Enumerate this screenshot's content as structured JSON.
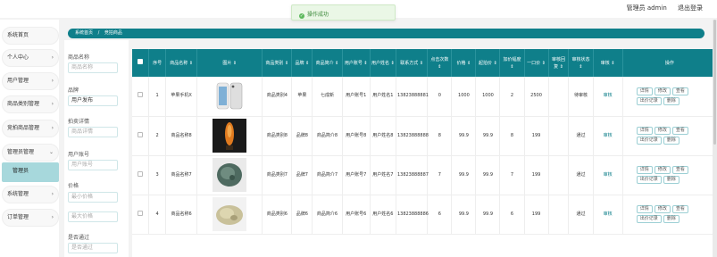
{
  "header": {
    "user_label": "管理员 admin",
    "logout": "退出登录"
  },
  "toast": {
    "message": "操作成功"
  },
  "sidebar": {
    "items": [
      {
        "label": "系统首页"
      },
      {
        "label": "个人中心"
      },
      {
        "label": "用户管理"
      },
      {
        "label": "商品类别管理"
      },
      {
        "label": "竞拍商品管理"
      },
      {
        "label": "管理员管理"
      },
      {
        "label": "系统管理"
      },
      {
        "label": "订单管理"
      }
    ],
    "active_sub": "管理员"
  },
  "breadcrumb": {
    "home": "系统首页",
    "sep": "/",
    "current": "竞拍商品"
  },
  "filters": [
    {
      "label": "商品名称",
      "placeholder": "商品名称",
      "value": ""
    },
    {
      "label": "品牌",
      "placeholder": "",
      "value": "用户发布"
    },
    {
      "label": "拍卖详情",
      "placeholder": "商品详情",
      "value": ""
    },
    {
      "label": "用户账号",
      "placeholder": "用户账号",
      "value": ""
    },
    {
      "label": "价格",
      "placeholder": "最小价格",
      "value": ""
    },
    {
      "label": "",
      "placeholder": "最大价格",
      "value": ""
    },
    {
      "label": "是否通过",
      "placeholder": "是否通过",
      "value": ""
    }
  ],
  "table": {
    "columns": [
      "",
      "序号",
      "商品名称 ⇕",
      "图片 ⇕",
      "商品类别 ⇕",
      "品牌 ⇕",
      "商品简介 ⇕",
      "用户账号 ⇕",
      "用户姓名 ⇕",
      "联系方式 ⇕",
      "点击次数 ⇕",
      "价格 ⇕",
      "起拍价 ⇕",
      "加价幅度 ⇕",
      "一口价 ⇕",
      "审核回复 ⇕",
      "审核状态 ⇕",
      "审核 ⇕",
      "操作"
    ],
    "rows": [
      {
        "no": "1",
        "name": "苹果手机X",
        "category": "商品类别4",
        "brand": "苹果",
        "intro": "七成新",
        "account": "用户账号1",
        "username": "用户姓名1",
        "phone": "13823888881",
        "clicks": "0",
        "price": "1000",
        "start": "1000",
        "step": "2",
        "buyout": "2500",
        "reply": "",
        "status": "待审核",
        "audit": "审核",
        "img": "phone"
      },
      {
        "no": "2",
        "name": "商品名称8",
        "category": "商品类别8",
        "brand": "品牌8",
        "intro": "商品简介8",
        "account": "用户账号8",
        "username": "用户姓名8",
        "phone": "13823888888",
        "clicks": "8",
        "price": "99.9",
        "start": "99.9",
        "step": "8",
        "buyout": "199",
        "reply": "",
        "status": "通过",
        "audit": "审核",
        "img": "amber"
      },
      {
        "no": "3",
        "name": "商品名称7",
        "category": "商品类别7",
        "brand": "品牌7",
        "intro": "商品简介7",
        "account": "用户账号7",
        "username": "用户姓名7",
        "phone": "13823888887",
        "clicks": "7",
        "price": "99.9",
        "start": "99.9",
        "step": "7",
        "buyout": "199",
        "reply": "",
        "status": "通过",
        "audit": "审核",
        "img": "jade"
      },
      {
        "no": "4",
        "name": "商品名称6",
        "category": "商品类别6",
        "brand": "品牌6",
        "intro": "商品简介6",
        "account": "用户账号6",
        "username": "用户姓名6",
        "phone": "13823888886",
        "clicks": "6",
        "price": "99.9",
        "start": "99.9",
        "step": "6",
        "buyout": "199",
        "reply": "",
        "status": "通过",
        "audit": "审核",
        "img": "stone"
      }
    ],
    "ops": [
      "详情",
      "修改",
      "查看",
      "出价记录",
      "删除"
    ]
  },
  "colors": {
    "accent": "#0f7f8a",
    "sub_active": "#a7d8dc"
  }
}
